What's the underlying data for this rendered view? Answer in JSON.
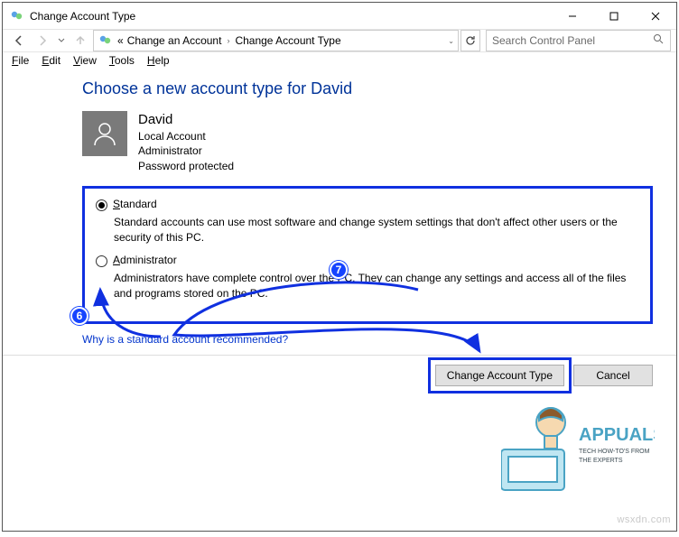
{
  "window": {
    "title": "Change Account Type"
  },
  "nav": {
    "breadcrumb_prefix": "«",
    "breadcrumb1": "Change an Account",
    "breadcrumb2": "Change Account Type",
    "search_placeholder": "Search Control Panel"
  },
  "menu": {
    "file": "File",
    "edit": "Edit",
    "view": "View",
    "tools": "Tools",
    "help": "Help"
  },
  "page": {
    "heading": "Choose a new account type for David",
    "user": {
      "name": "David",
      "line1": "Local Account",
      "line2": "Administrator",
      "line3": "Password protected"
    },
    "options": {
      "standard": {
        "label_prefix": "S",
        "label_rest": "tandard",
        "desc": "Standard accounts can use most software and change system settings that don't affect other users or the security of this PC."
      },
      "admin": {
        "label_prefix": "A",
        "label_rest": "dministrator",
        "desc": "Administrators have complete control over the PC. They can change any settings and access all of the files and programs stored on the PC."
      }
    },
    "link": "Why is a standard account recommended?"
  },
  "actions": {
    "primary": "Change Account Type",
    "cancel": "Cancel"
  },
  "annotations": {
    "badge6": "6",
    "badge7": "7"
  },
  "brand": {
    "name": "APPUALS",
    "tag1": "TECH HOW-TO'S FROM",
    "tag2": "THE EXPERTS",
    "watermark": "wsxdn.com"
  }
}
